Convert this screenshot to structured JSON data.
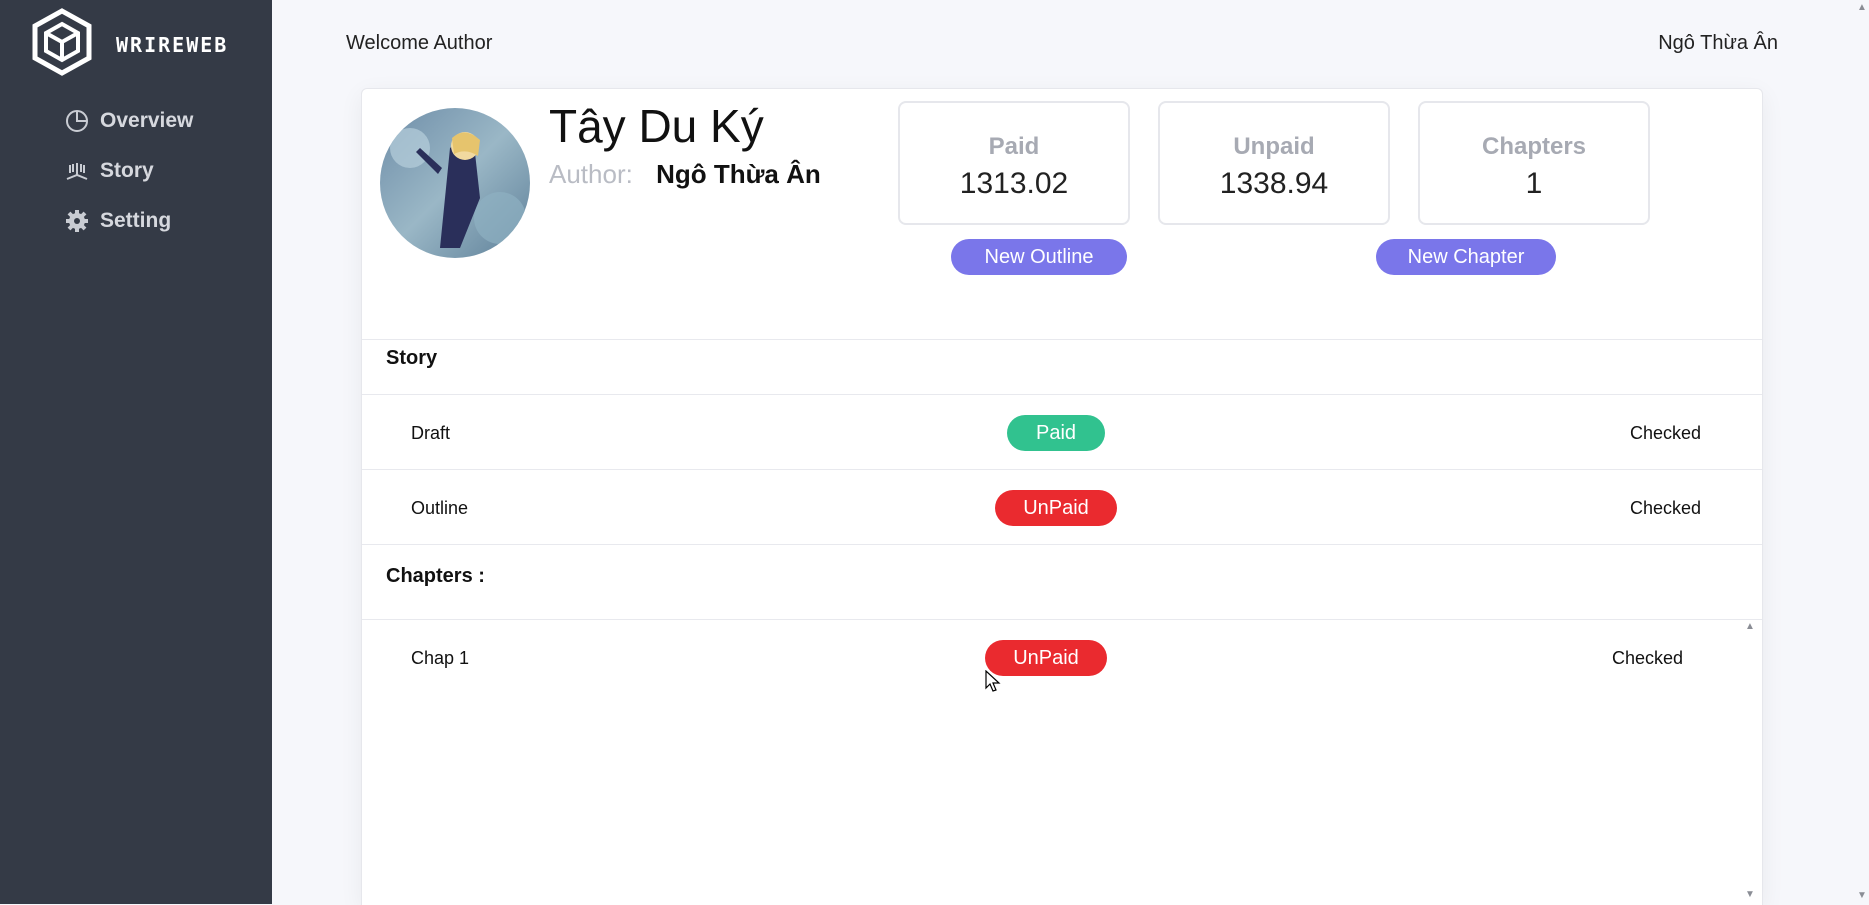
{
  "brand": {
    "name": "WRIREWEB"
  },
  "sidebar": {
    "items": [
      {
        "label": "Overview",
        "icon": "pie-chart-icon"
      },
      {
        "label": "Story",
        "icon": "book-icon"
      },
      {
        "label": "Setting",
        "icon": "gear-icon"
      }
    ]
  },
  "header": {
    "welcome": "Welcome Author",
    "user_name": "Ngô Thừa Ân"
  },
  "story": {
    "title": "Tây Du Ký",
    "author_label": "Author:",
    "author_name": "Ngô Thừa Ân"
  },
  "stats": [
    {
      "label": "Paid",
      "value": "1313.02"
    },
    {
      "label": "Unpaid",
      "value": "1338.94"
    },
    {
      "label": "Chapters",
      "value": "1"
    }
  ],
  "buttons": {
    "new_outline": "New Outline",
    "new_chapter": "New Chapter"
  },
  "sections": {
    "story_title": "Story",
    "chapters_title": "Chapters :"
  },
  "story_rows": [
    {
      "label": "Draft",
      "status": "Paid",
      "check": "Checked"
    },
    {
      "label": "Outline",
      "status": "UnPaid",
      "check": "Checked"
    }
  ],
  "chapter_rows": [
    {
      "label": "Chap 1",
      "status": "UnPaid",
      "check": "Checked"
    }
  ],
  "colors": {
    "sidebar_bg": "#343a46",
    "accent": "#7a76ea",
    "paid": "#31c28f",
    "unpaid": "#ea2a2f"
  }
}
